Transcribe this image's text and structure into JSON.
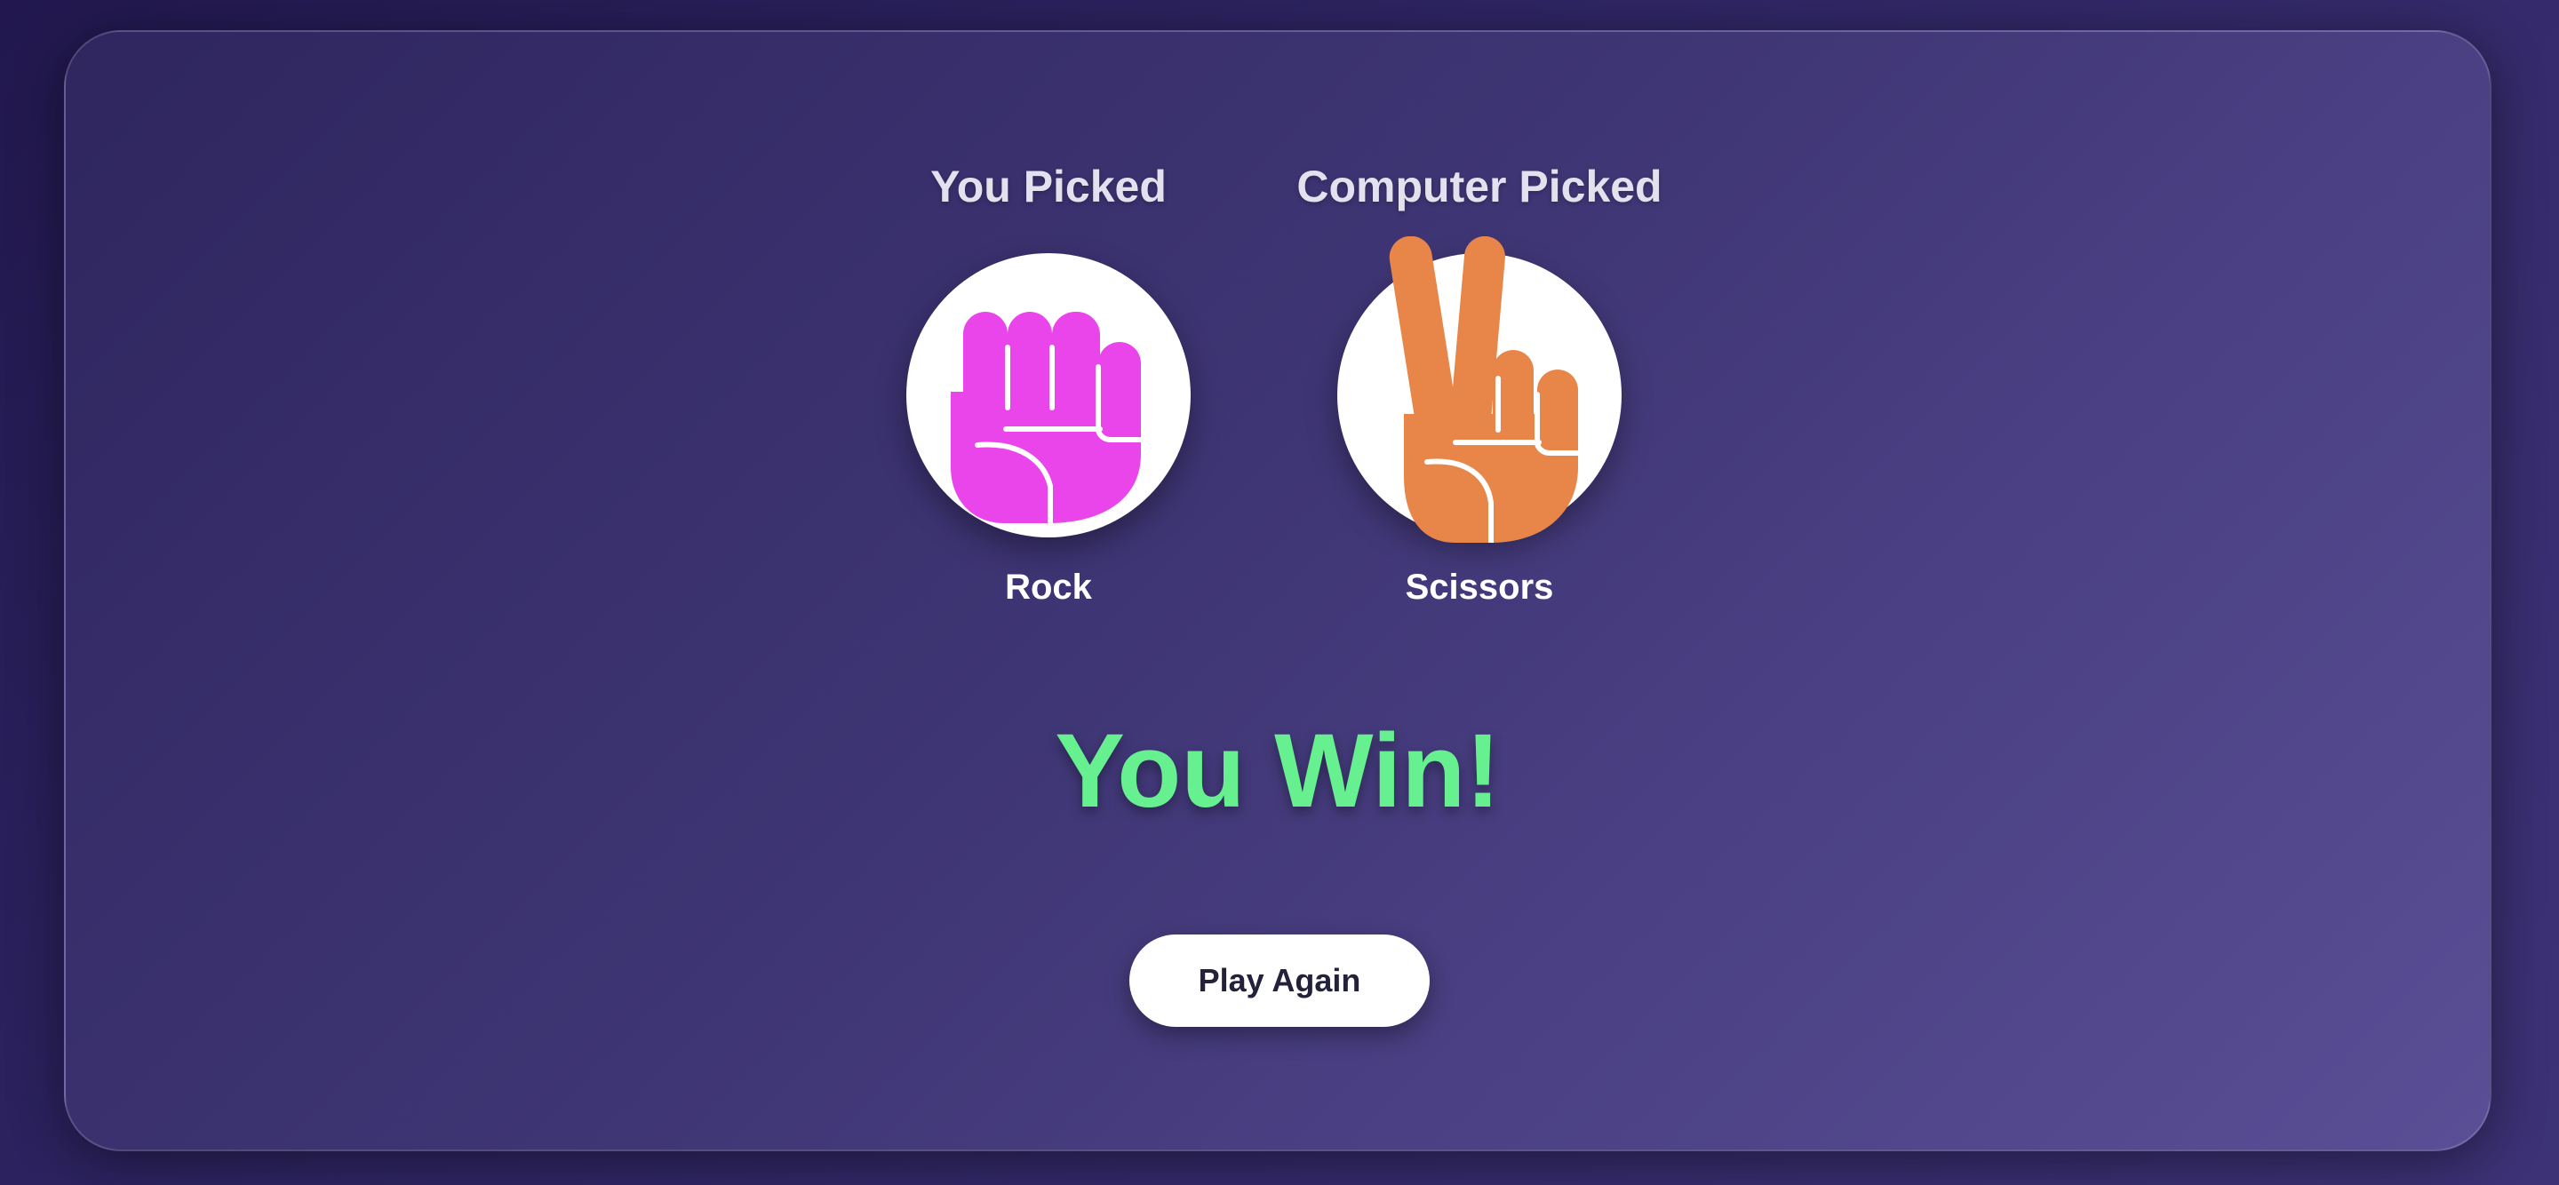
{
  "player": {
    "heading": "You Picked",
    "choice_label": "Rock",
    "choice_icon": "fist-icon",
    "color": "#ea45ea"
  },
  "computer": {
    "heading": "Computer Picked",
    "choice_label": "Scissors",
    "choice_icon": "peace-hand-icon",
    "color": "#e8864a"
  },
  "result": {
    "text": "You Win!",
    "color": "#66f08f"
  },
  "actions": {
    "play_again_label": "Play Again"
  }
}
